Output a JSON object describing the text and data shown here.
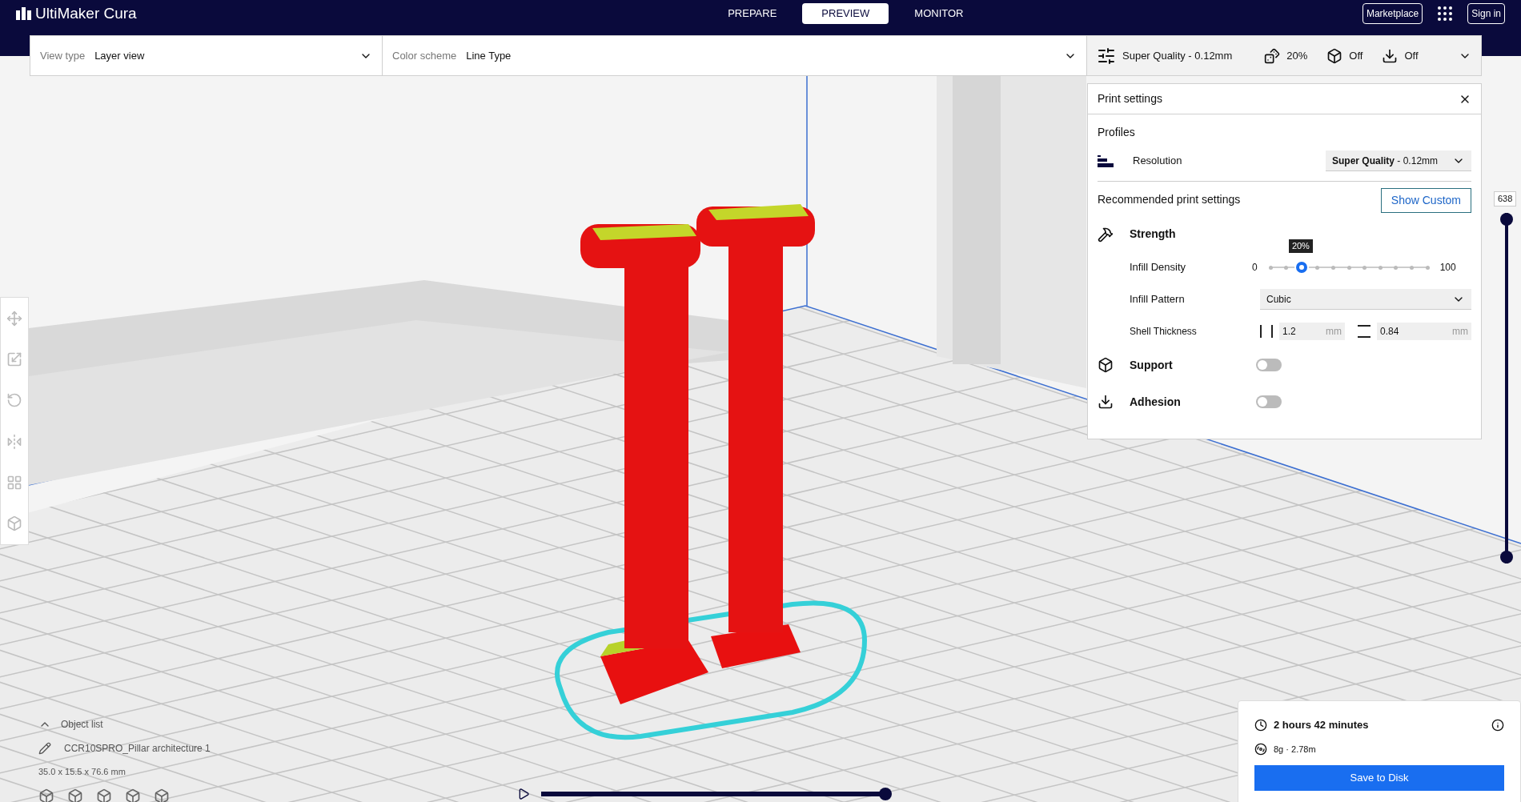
{
  "header": {
    "logo": "UltiMaker Cura",
    "stages": [
      {
        "label": "PREPARE",
        "selected": false
      },
      {
        "label": "PREVIEW",
        "selected": true
      },
      {
        "label": "MONITOR",
        "selected": false
      }
    ],
    "marketplace": "Marketplace",
    "sign_in": "Sign in"
  },
  "view_bar": {
    "view_type_label": "View type",
    "view_type": "Layer view",
    "color_scheme_label": "Color scheme",
    "color_scheme": "Line Type",
    "profile": "Super Quality - 0.12mm",
    "infill": "20%",
    "support": "Off",
    "adhesion": "Off"
  },
  "print_settings": {
    "title": "Print settings",
    "profiles_heading": "Profiles",
    "resolution_label": "Resolution",
    "resolution_value": "**Super Quality** - 0.12mm",
    "recommended_heading": "Recommended print settings",
    "show_custom": "Show Custom",
    "strength": "Strength",
    "infill_density_label": "Infill Density",
    "infill_min": "0",
    "infill_max": "100",
    "infill_tooltip": "20%",
    "infill_slider": {
      "level": 0.2
    },
    "infill_pattern_label": "Infill Pattern",
    "infill_pattern": "Cubic",
    "shell_label": "Shell Thickness",
    "wall_value": "1.2",
    "wall_unit": "mm",
    "top_value": "0.84",
    "top_unit": "mm",
    "toggles": [
      {
        "label": "Support",
        "kind": "support",
        "on": false
      },
      {
        "label": "Adhesion",
        "kind": "adhesion",
        "on": false
      }
    ]
  },
  "layer_slider": {
    "value": "638",
    "level": 1
  },
  "object_list": {
    "heading": "Object list",
    "object": "CCR10SPRO_Pillar architecture 1",
    "dimensions": "35.0 x 15.5 x 76.6 mm"
  },
  "timeline": {
    "level": 1
  },
  "summary": {
    "time": "2 hours 42 minutes",
    "material": "8g · 2.78m",
    "button": "Save to Disk"
  }
}
